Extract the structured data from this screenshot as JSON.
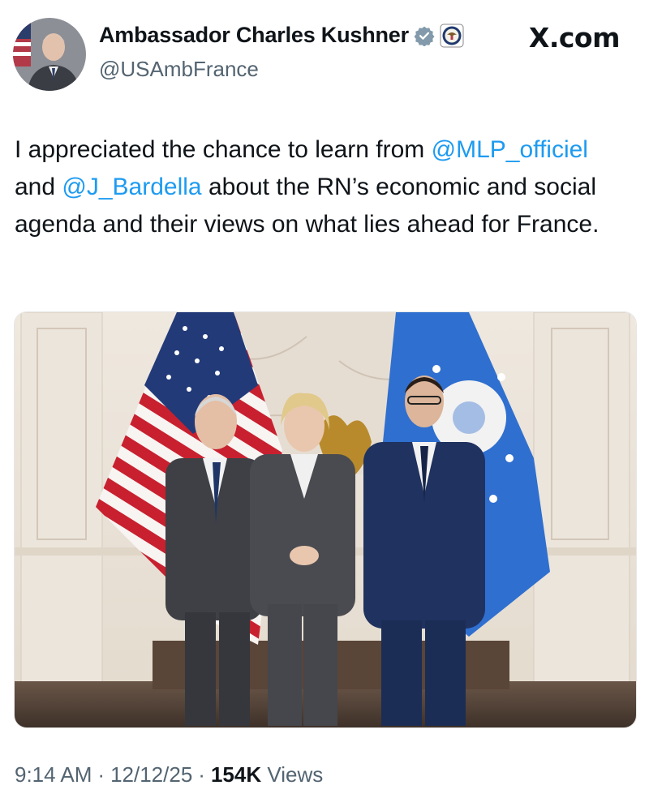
{
  "author": {
    "display_name": "Ambassador Charles Kushner",
    "handle": "@USAmbFrance"
  },
  "brand": {
    "site": "X.com"
  },
  "tweet": {
    "text_parts": [
      "I appreciated the chance to learn from ",
      "@MLP_officiel",
      " and ",
      "@J_Bardella",
      " about the RN’s economic and social agenda and their views on what lies ahead for France."
    ]
  },
  "meta": {
    "time": "9:14 AM",
    "sep1": "·",
    "date": "12/12/25",
    "sep2": "·",
    "views_count": "154K",
    "views_label": "Views"
  },
  "colors": {
    "link": "#1d9bf0",
    "muted": "#536471",
    "verified": "#829aab"
  }
}
